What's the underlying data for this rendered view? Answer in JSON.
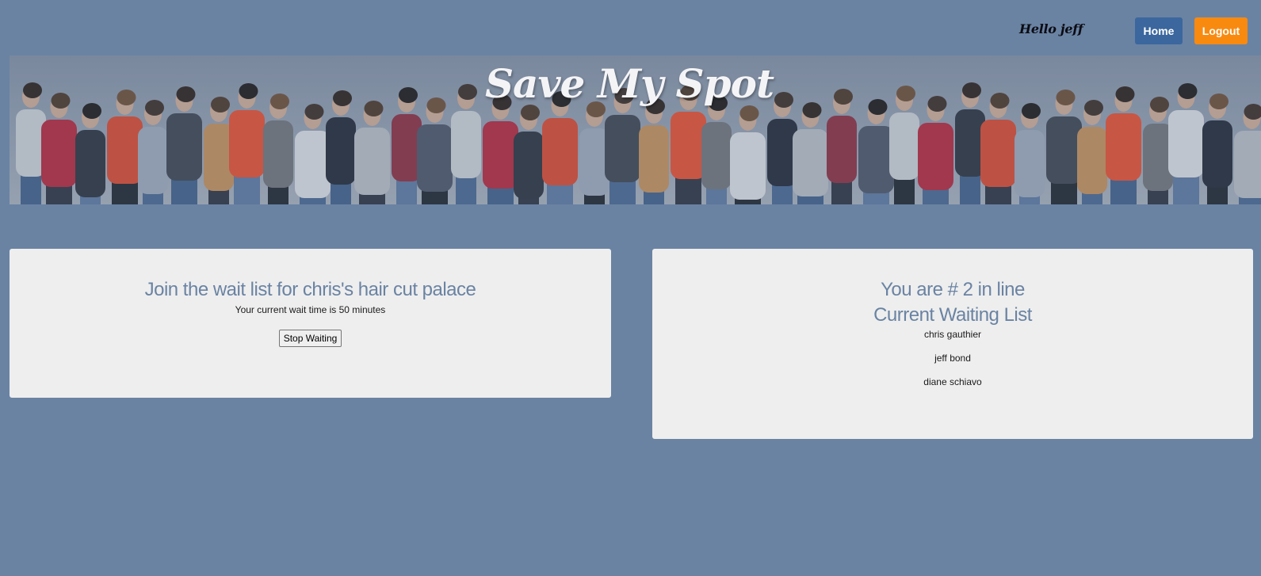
{
  "nav": {
    "greeting": "Hello jeff",
    "home_label": "Home",
    "logout_label": "Logout"
  },
  "banner": {
    "title": "Save My Spot"
  },
  "join_panel": {
    "heading": "Join the wait list for chris's hair cut palace",
    "wait_text": "Your current wait time is 50 minutes",
    "stop_button": "Stop Waiting"
  },
  "list_panel": {
    "position_heading": "You are # 2 in line",
    "list_heading": "Current Waiting List",
    "names": [
      "chris gauthier",
      "jeff bond",
      "diane schiavo"
    ]
  },
  "colors": {
    "background": "#6a83a3",
    "home_button": "#3b679e",
    "logout_button": "#f98a10",
    "panel": "#eeeeee"
  }
}
